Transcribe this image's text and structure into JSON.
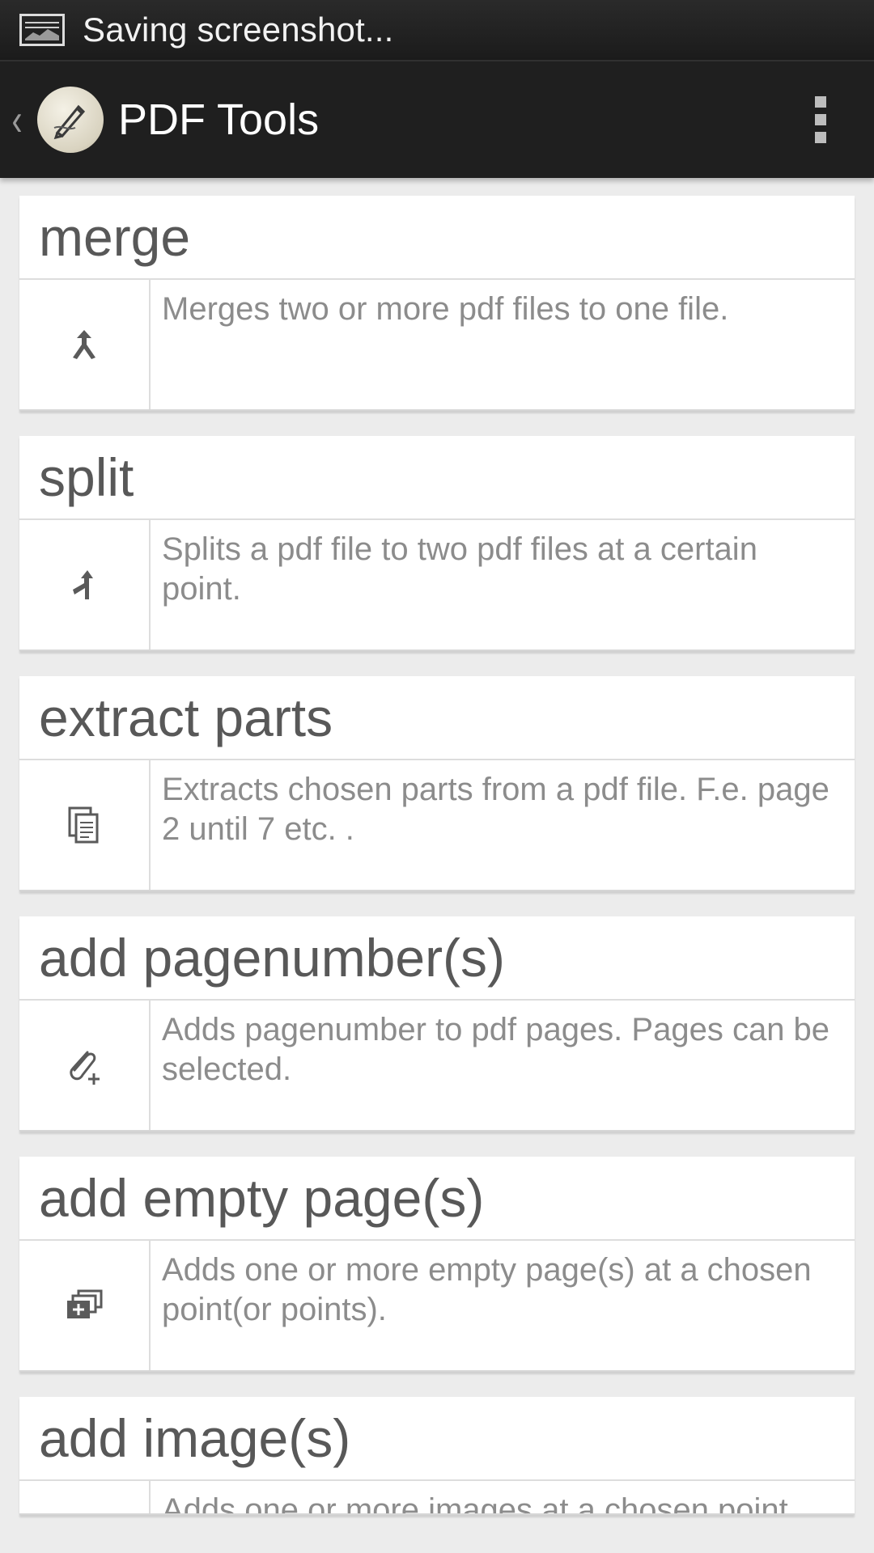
{
  "status_bar": {
    "notification_icon": "screenshot-icon",
    "text": "Saving screenshot..."
  },
  "action_bar": {
    "back_icon": "back-chevron-icon",
    "back_glyph": "‹",
    "logo_icon": "pdf-tools-logo-icon",
    "title": "PDF Tools",
    "menu_icon": "overflow-menu-icon"
  },
  "tools": [
    {
      "title": "merge",
      "icon": "merge-icon",
      "description": "Merges two or more pdf files to one file."
    },
    {
      "title": "split",
      "icon": "split-icon",
      "description": "Splits a pdf file to two pdf files at a certain point."
    },
    {
      "title": "extract parts",
      "icon": "copy-pages-icon",
      "description": "Extracts chosen parts from a pdf file. F.e. page 2 until 7 etc. ."
    },
    {
      "title": "add pagenumber(s)",
      "icon": "attach-plus-icon",
      "description": "Adds pagenumber to pdf pages. Pages can be selected."
    },
    {
      "title": "add empty page(s)",
      "icon": "add-pages-icon",
      "description": "Adds one or more empty page(s) at a chosen point(or points)."
    },
    {
      "title": "add image(s)",
      "icon": "add-image-icon",
      "description": "Adds one or more images at a chosen point"
    }
  ],
  "colors": {
    "status_bar_bg": "#1b1b1b",
    "action_bar_bg": "#1f1f1f",
    "page_bg": "#ececec",
    "card_bg": "#ffffff",
    "title_text": "#585858",
    "desc_text": "#8c8c8c"
  }
}
